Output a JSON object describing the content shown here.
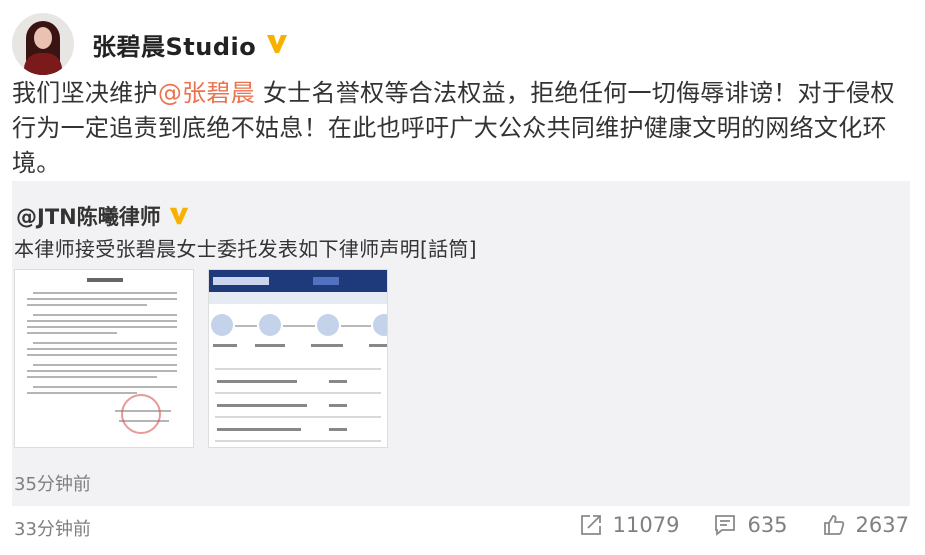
{
  "post": {
    "author": "张碧晨Studio",
    "text_before_mention": "我们坚决维护",
    "mention": "@张碧晨",
    "text_after_mention": " 女士名誉权等合法权益，拒绝任何一切侮辱诽谤！对于侵权行为一定追责到底绝不姑息！在此也呼吁广大公众共同维护健康文明的网络文化环境。",
    "time": "33分钟前",
    "actions": {
      "repost_count": "11079",
      "comment_count": "635",
      "like_count": "2637"
    }
  },
  "repost": {
    "author": "@JTN陈曦律师",
    "text": "本律师接受张碧晨女士委托发表如下律师声明[話筒]",
    "time": "35分钟前",
    "images": [
      "lawyer-statement-document-image",
      "court-website-screenshot-image"
    ]
  },
  "colors": {
    "mention": "#eb7350",
    "verified_badge": "#f8b100",
    "repost_background": "#f2f2f5",
    "meta_text": "#808080"
  },
  "icons": {
    "verified": "verified-badge-icon",
    "repost": "repost-icon",
    "comment": "comment-icon",
    "like": "like-icon"
  }
}
